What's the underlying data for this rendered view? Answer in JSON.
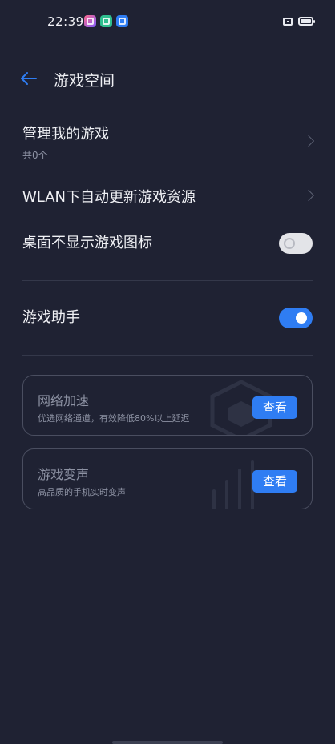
{
  "status_bar": {
    "time": "22:39",
    "app_icons": [
      "photos-app-icon",
      "green-app-icon",
      "blue-app-icon"
    ]
  },
  "header": {
    "title": "游戏空间"
  },
  "settings": {
    "manage_games": {
      "title": "管理我的游戏",
      "subtitle": "共0个"
    },
    "wlan_update": {
      "title": "WLAN下自动更新游戏资源"
    },
    "hide_desktop_icon": {
      "title": "桌面不显示游戏图标",
      "enabled": false
    },
    "game_assistant": {
      "title": "游戏助手",
      "enabled": true
    }
  },
  "cards": [
    {
      "title": "网络加速",
      "subtitle": "优选网络通道，有效降低80%以上延迟",
      "button": "查看"
    },
    {
      "title": "游戏变声",
      "subtitle": "高品质的手机实时变声",
      "button": "查看"
    }
  ],
  "colors": {
    "background": "#1f2233",
    "accent": "#2f7df3",
    "text_primary": "#f0f1f5",
    "text_secondary": "#8e93a5"
  }
}
